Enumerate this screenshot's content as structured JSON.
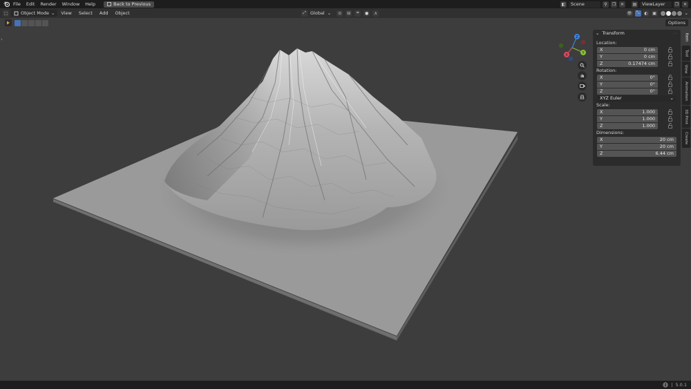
{
  "topbar": {
    "menus": [
      "File",
      "Edit",
      "Render",
      "Window",
      "Help"
    ],
    "back_button": "Back to Previous",
    "scene": "Scene",
    "view_layer": "ViewLayer"
  },
  "viewport_header": {
    "mode": "Object Mode",
    "menus": [
      "View",
      "Select",
      "Add",
      "Object"
    ],
    "orientation": "Global"
  },
  "tool_settings": {
    "options": "Options"
  },
  "gizmo": {
    "x": "X",
    "y": "Y",
    "z": "Z"
  },
  "npanel": {
    "section": "Transform",
    "location": {
      "label": "Location:",
      "fields": [
        {
          "axis": "X",
          "value": "0 cm"
        },
        {
          "axis": "Y",
          "value": "0 cm"
        },
        {
          "axis": "Z",
          "value": "0.17474 cm"
        }
      ]
    },
    "rotation": {
      "label": "Rotation:",
      "fields": [
        {
          "axis": "X",
          "value": "0°"
        },
        {
          "axis": "Y",
          "value": "0°"
        },
        {
          "axis": "Z",
          "value": "0°"
        }
      ],
      "mode": "XYZ Euler"
    },
    "scale": {
      "label": "Scale:",
      "fields": [
        {
          "axis": "X",
          "value": "1.000"
        },
        {
          "axis": "Y",
          "value": "1.000"
        },
        {
          "axis": "Z",
          "value": "1.000"
        }
      ]
    },
    "dimensions": {
      "label": "Dimensions:",
      "fields": [
        {
          "axis": "X",
          "value": "20 cm"
        },
        {
          "axis": "Y",
          "value": "20 cm"
        },
        {
          "axis": "Z",
          "value": "6.44 cm"
        }
      ]
    },
    "tabs": [
      "Item",
      "Tool",
      "View",
      "Animation",
      "3D Print",
      "Create"
    ]
  },
  "statusbar": {
    "version": "5.0.1"
  },
  "colors": {
    "accent": "#4772b3",
    "axis_x": "#e04a5f",
    "axis_y": "#8bc034",
    "axis_z": "#3c84e0"
  }
}
